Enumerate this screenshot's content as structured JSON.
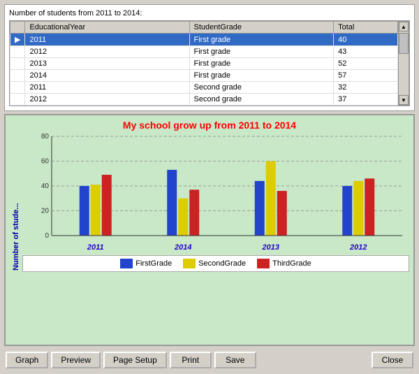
{
  "table": {
    "title": "Number of students from 2011 to 2014:",
    "columns": [
      "",
      "EducationalYear",
      "StudentGrade",
      "Total"
    ],
    "rows": [
      {
        "indicator": "▶",
        "year": "2011",
        "grade": "First grade",
        "total": "40",
        "selected": true
      },
      {
        "indicator": "",
        "year": "2012",
        "grade": "First grade",
        "total": "43",
        "selected": false
      },
      {
        "indicator": "",
        "year": "2013",
        "grade": "First grade",
        "total": "52",
        "selected": false
      },
      {
        "indicator": "",
        "year": "2014",
        "grade": "First grade",
        "total": "57",
        "selected": false
      },
      {
        "indicator": "",
        "year": "2011",
        "grade": "Second grade",
        "total": "32",
        "selected": false
      },
      {
        "indicator": "",
        "year": "2012",
        "grade": "Second grade",
        "total": "37",
        "selected": false
      }
    ]
  },
  "chart": {
    "title": "My school grow up from 2011 to 2014",
    "y_axis_label": "Number of stude...",
    "y_ticks": [
      "80",
      "60",
      "40",
      "20",
      "0"
    ],
    "groups": [
      {
        "label": "2011",
        "blue": 40,
        "yellow": 41,
        "red": 49
      },
      {
        "label": "2014",
        "blue": 53,
        "yellow": 30,
        "red": 37
      },
      {
        "label": "2013",
        "blue": 44,
        "yellow": 60,
        "red": 36
      },
      {
        "label": "2012",
        "blue": 40,
        "yellow": 44,
        "red": 46
      }
    ],
    "max_value": 80,
    "legend": [
      {
        "color": "#2244cc",
        "label": "FirstGrade"
      },
      {
        "color": "#ddcc00",
        "label": "SecondGrade"
      },
      {
        "color": "#cc2222",
        "label": "ThirdGrade"
      }
    ]
  },
  "toolbar": {
    "buttons": [
      "Graph",
      "Preview",
      "Page Setup",
      "Print",
      "Save",
      "Close"
    ]
  }
}
